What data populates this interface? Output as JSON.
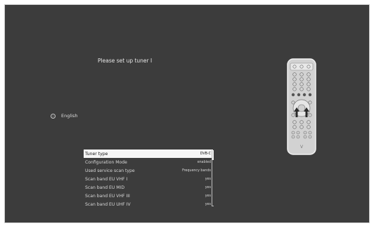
{
  "wizard": {
    "title": "Please set up tuner I",
    "language": "English"
  },
  "settings": [
    {
      "label": "Tuner type",
      "value": "DVB-C",
      "selected": true
    },
    {
      "label": "Configuration Mode",
      "value": "enabled",
      "selected": false
    },
    {
      "label": "Used service scan type",
      "value": "Frequency bands",
      "selected": false
    },
    {
      "label": "Scan band EU VHF I",
      "value": "yes",
      "selected": false
    },
    {
      "label": "Scan band EU MID",
      "value": "yes",
      "selected": false
    },
    {
      "label": "Scan band EU VHF III",
      "value": "yes",
      "selected": false
    },
    {
      "label": "Scan band EU UHF IV",
      "value": "yes",
      "selected": false
    }
  ],
  "remote_logo": "V"
}
